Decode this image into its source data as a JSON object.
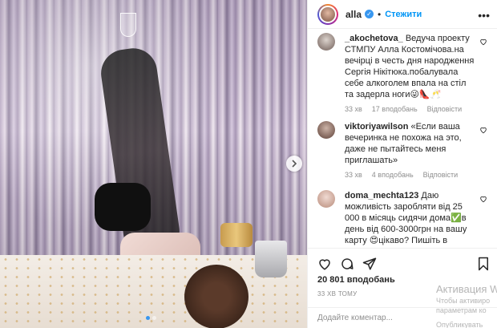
{
  "header": {
    "username": "alla",
    "separator": "•",
    "follow_label": "Стежити",
    "more_label": "•••"
  },
  "comments": [
    {
      "username": "_akochetova_",
      "text": "Ведуча проекту СТМПУ Алла Костомічова.на вечірці в честь дня народження Сергія Нікітюка.побалувала себе алкоголем впала на стіл та задерла ноги😜👠🥂",
      "time": "33 хв",
      "likes": "17 вподобань",
      "reply": "Відповісти"
    },
    {
      "username": "viktoriyawilson",
      "text": "«Если ваша вечеринка не похожа на это, даже не пытайтесь меня приглашать»",
      "time": "33 хв",
      "likes": "4 вподобань",
      "reply": "Відповісти"
    },
    {
      "username": "doma_mechta123",
      "text": "Даю можливість заробляти від 25 000 в місяць сидячи дома✅в день від 600-3000грн на вашу карту 😍цікаво? Пишіть в дірект",
      "time": "",
      "likes": "",
      "reply": ""
    }
  ],
  "likes_count": "20 801 вподобань",
  "time_ago": "33 ХВ ТОМУ",
  "add_comment_placeholder": "Додайте коментар...",
  "watermark": {
    "title": "Активация W",
    "line1": "Чтобы активиро",
    "line2": "параметрам ко",
    "button": "Опубликувать"
  },
  "colors": {
    "accent": "#0095f6",
    "verified": "#3897f0",
    "muted": "#8e8e8e",
    "text": "#262626"
  },
  "icons": {
    "like": "heart-icon",
    "comment": "comment-icon",
    "share": "share-icon",
    "save": "bookmark-icon",
    "next": "chevron-right-icon"
  }
}
